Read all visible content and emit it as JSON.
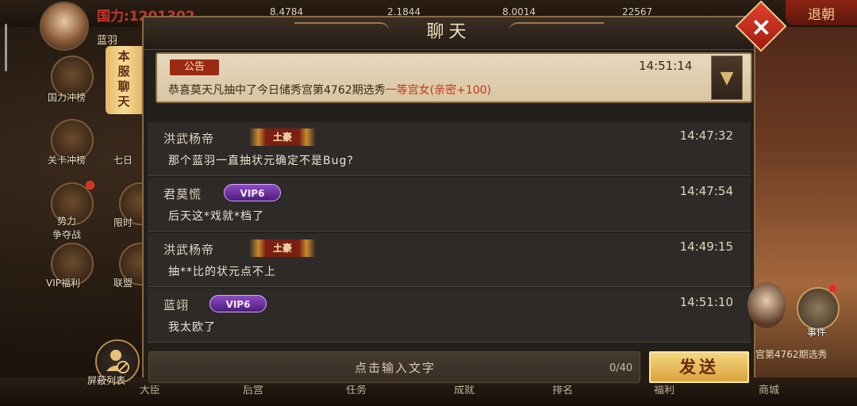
{
  "topbar": {
    "power_label": "国力:1201302…",
    "stats": [
      "8.4784",
      "2.1844",
      "8.0014",
      "22567"
    ],
    "avatar_name": "蓝羽",
    "retreat_button": "退朝"
  },
  "sidebar": {
    "items": [
      {
        "label": "国力冲榜"
      },
      {
        "label": "关卡冲榜"
      },
      {
        "label": "七日"
      },
      {
        "label": "势力\n争夺战"
      },
      {
        "label": "限时"
      },
      {
        "label": "VIP福利"
      },
      {
        "label": "联盟"
      }
    ],
    "hide_list_label": "屏蔽列表"
  },
  "chat": {
    "title": "聊天",
    "server_tab": "本服聊天",
    "notice": {
      "tag": "公告",
      "time": "14:51:14",
      "text_prefix": "恭喜莫天凡抽中了今日储秀宫第4762期选秀",
      "text_highlight": "一等宫女(亲密+100)"
    },
    "messages": [
      {
        "name": "洪武杨帝",
        "badge": "土豪",
        "badge_type": "tuhao",
        "time": "14:47:32",
        "text": "那个蓝羽一直抽状元确定不是Bug?"
      },
      {
        "name": "君莫慌",
        "badge": "VIP6",
        "badge_type": "vip",
        "time": "14:47:54",
        "text": "后天这*戏就*档了"
      },
      {
        "name": "洪武杨帝",
        "badge": "土豪",
        "badge_type": "tuhao",
        "time": "14:49:15",
        "text": "抽**比的状元点不上"
      },
      {
        "name": "蓝翊",
        "badge": "VIP6",
        "badge_type": "vip",
        "time": "14:51:10",
        "text": "我太欧了"
      }
    ],
    "input": {
      "placeholder": "点击输入文字",
      "count": "0/40",
      "send_label": "发送"
    }
  },
  "right_panel": {
    "scroll_text": "宫第4762期选秀",
    "event_label": "事件"
  },
  "bottom_nav": {
    "items": [
      "大臣",
      "后宫",
      "任务",
      "成就",
      "排名",
      "福利",
      "商城"
    ]
  },
  "colors": {
    "accent_gold": "#f4d680",
    "notice_highlight": "#c0391e",
    "close_red": "#e4422c"
  }
}
